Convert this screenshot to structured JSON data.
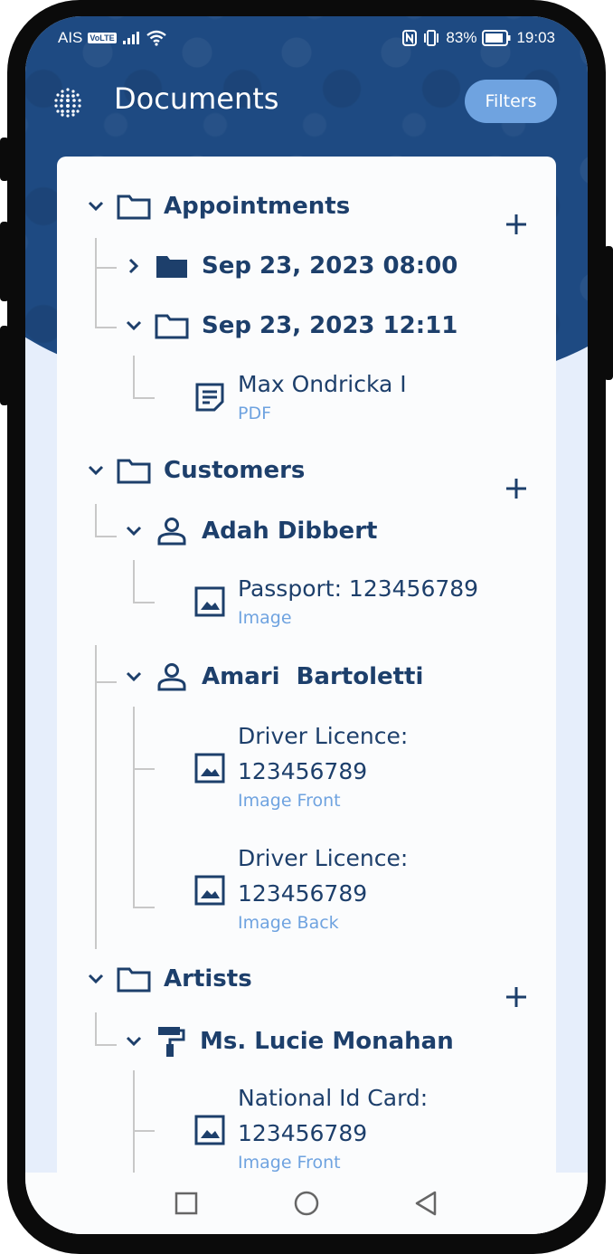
{
  "status_bar": {
    "carrier": "AIS",
    "volte": "VoLTE",
    "battery": "83%",
    "time": "19:03"
  },
  "header": {
    "title": "Documents",
    "filters_label": "Filters"
  },
  "groups": [
    {
      "label": "Appointments",
      "children": [
        {
          "label": "Sep 23, 2023 08:00",
          "expanded": false,
          "icon": "folder-filled-icon"
        },
        {
          "label": "Sep 23, 2023 12:11",
          "expanded": true,
          "icon": "folder-icon",
          "documents": [
            {
              "title": "Max Ondricka I",
              "subtitle": "PDF",
              "icon": "document-icon"
            }
          ]
        }
      ]
    },
    {
      "label": "Customers",
      "children": [
        {
          "label": "Adah Dibbert",
          "expanded": true,
          "icon": "person-icon",
          "documents": [
            {
              "title": "Passport: 123456789",
              "subtitle": "Image",
              "icon": "image-icon"
            }
          ]
        },
        {
          "label": "Amari  Bartoletti",
          "expanded": true,
          "icon": "person-icon",
          "documents": [
            {
              "title_line1": "Driver Licence:",
              "title_line2": "123456789",
              "subtitle": "Image Front",
              "icon": "image-icon"
            },
            {
              "title_line1": "Driver Licence:",
              "title_line2": "123456789",
              "subtitle": "Image Back",
              "icon": "image-icon"
            }
          ]
        }
      ]
    },
    {
      "label": "Artists",
      "children": [
        {
          "label": "Ms. Lucie Monahan",
          "expanded": true,
          "icon": "paint-roller-icon",
          "documents": [
            {
              "title_line1": "National Id Card:",
              "title_line2": "123456789",
              "subtitle": "Image Front",
              "icon": "image-icon"
            }
          ]
        }
      ]
    }
  ],
  "colors": {
    "primary": "#1d3f6b",
    "accent": "#6fa3e0",
    "header_bg": "#1e4a82"
  }
}
